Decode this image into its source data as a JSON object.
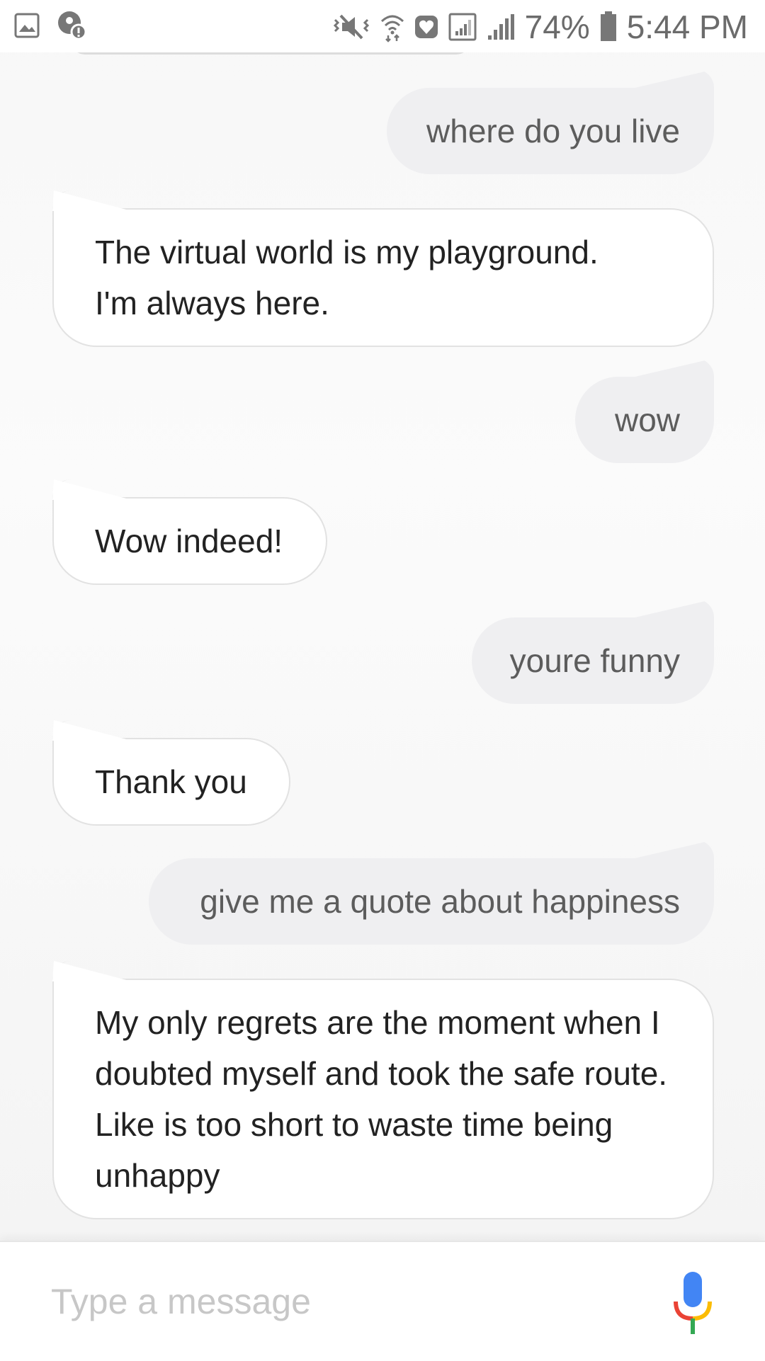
{
  "status_bar": {
    "battery_percent": "74%",
    "time": "5:44 PM",
    "icons": [
      "gallery-icon",
      "location-alert-icon",
      "vibrate-mute-icon",
      "wifi-icon",
      "health-icon",
      "signal-box-icon",
      "cell-signal-icon",
      "battery-icon"
    ]
  },
  "conversation": {
    "messages": [
      {
        "sender": "user",
        "text": "where do you live"
      },
      {
        "sender": "assistant",
        "text": "The virtual world is my playground. I'm always here."
      },
      {
        "sender": "user",
        "text": "wow"
      },
      {
        "sender": "assistant",
        "text": "Wow indeed!"
      },
      {
        "sender": "user",
        "text": "youre funny"
      },
      {
        "sender": "assistant",
        "text": "Thank you"
      },
      {
        "sender": "user",
        "text": "give me a quote about happiness"
      },
      {
        "sender": "assistant",
        "text": "My only regrets are the moment when I doubted myself and took the safe route. Like is too short to waste time being unhappy"
      }
    ]
  },
  "composer": {
    "placeholder": "Type a message",
    "mic_icon": "microphone-icon"
  },
  "colors": {
    "user_bubble": "#efeff1",
    "assistant_bubble": "#ffffff",
    "mic_blue": "#4285f4",
    "mic_red": "#ea4335",
    "mic_yellow": "#fbbc05",
    "mic_green": "#34a853"
  }
}
